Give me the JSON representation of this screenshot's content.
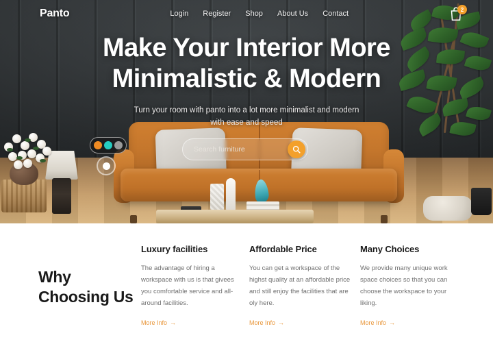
{
  "nav": {
    "logo": "Panto",
    "links": [
      {
        "label": "Login"
      },
      {
        "label": "Register"
      },
      {
        "label": "Shop"
      },
      {
        "label": "About Us"
      },
      {
        "label": "Contact"
      }
    ],
    "cart": {
      "icon": "shopping-bag-icon",
      "badge_count": "2",
      "badge_color": "#f3a02b"
    }
  },
  "hero": {
    "headline_line1": "Make Your Interior More",
    "headline_line2": "Minimalistic & Modern",
    "subtitle_line1": "Turn your room with panto into a lot more minimalist and modern",
    "subtitle_line2": "with ease and speed",
    "search": {
      "placeholder": "Search furniture",
      "value": "",
      "button_icon": "search-icon",
      "button_color": "#f3a02b"
    },
    "color_swatches": [
      {
        "name": "swatch-orange",
        "color": "#ef8b23"
      },
      {
        "name": "swatch-teal",
        "color": "#25ccc0"
      },
      {
        "name": "swatch-gray",
        "color": "#9a9a9a"
      }
    ],
    "hotspot": {
      "name": "product-hotspot",
      "color": "#ffffff"
    }
  },
  "why": {
    "title_line1": "Why",
    "title_line2": "Choosing Us",
    "columns": [
      {
        "title": "Luxury facilities",
        "body": "The advantage of hiring a workspace with us is that givees you comfortable service and all-around facilities.",
        "link": "More Info",
        "link_arrow": "→"
      },
      {
        "title": "Affordable Price",
        "body": "You can get a workspace of the highst quality at an affordable price and still enjoy the facilities that are oly here.",
        "link": "More Info",
        "link_arrow": "→"
      },
      {
        "title": "Many Choices",
        "body": "We provide many unique work space choices so that you can choose the workspace to your liking.",
        "link": "More Info",
        "link_arrow": "→"
      }
    ]
  },
  "theme": {
    "accent": "#f3a02b",
    "link": "#e8963a",
    "hero_bg": "#2e3234",
    "text_dark": "#1a1a1a",
    "text_muted": "#6f6f6f"
  }
}
